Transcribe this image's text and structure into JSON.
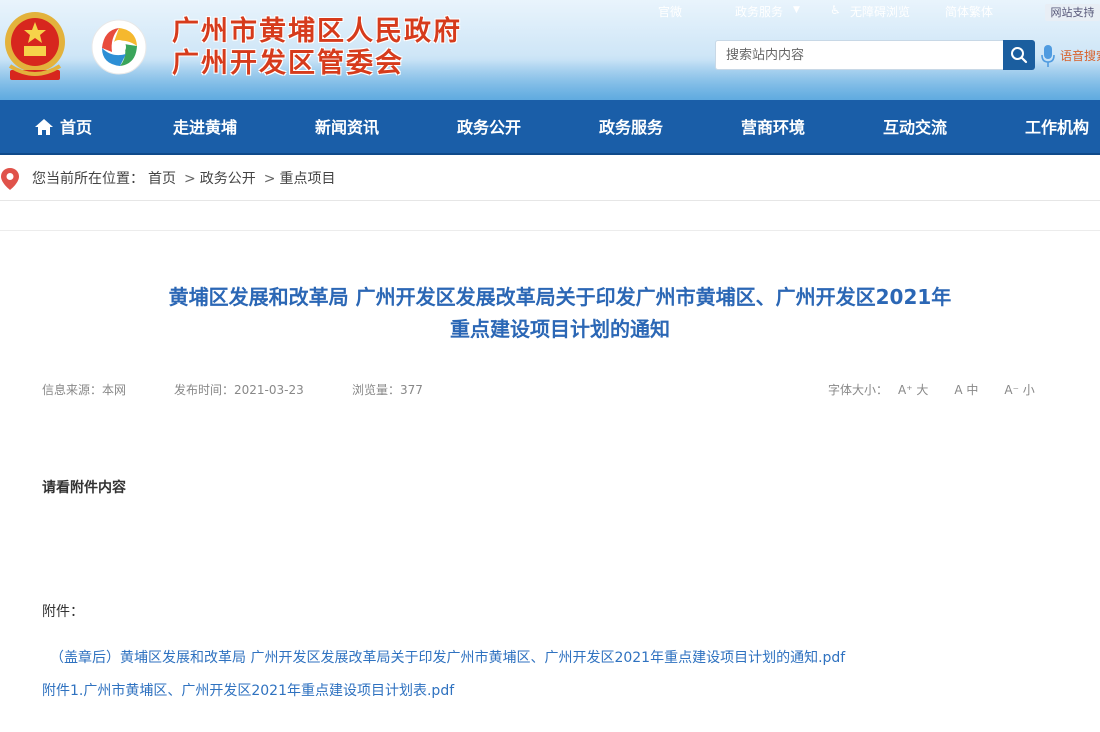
{
  "header": {
    "title_line1": "广州市黄埔区人民政府",
    "title_line2": "广州开发区管委会",
    "top_links": [
      "官微",
      "政务服务",
      "无障碍浏览",
      "简体繁体"
    ],
    "top_button": "网站支持",
    "search_placeholder": "搜索站内内容",
    "voice_label": "语音搜索"
  },
  "nav": {
    "items": [
      "首页",
      "走进黄埔",
      "新闻资讯",
      "政务公开",
      "政务服务",
      "营商环境",
      "互动交流",
      "工作机构"
    ]
  },
  "breadcrumb": {
    "prefix": "您当前所在位置：",
    "items": [
      "首页",
      "政务公开",
      "重点项目"
    ],
    "separator": ">"
  },
  "article": {
    "title_line1": "黄埔区发展和改革局 广州开发区发展改革局关于印发广州市黄埔区、广州开发区2021年",
    "title_line2": "重点建设项目计划的通知",
    "meta": {
      "source": "信息来源：本网",
      "date": "发布时间：2021-03-23",
      "views": "浏览量：377"
    },
    "font_size": {
      "label": "字体大小：",
      "options": [
        "A⁺ 大",
        "A 中",
        "A⁻ 小"
      ]
    },
    "body": "请看附件内容",
    "attachments_label": "附件：",
    "attachments": [
      "（盖章后）黄埔区发展和改革局 广州开发区发展改革局关于印发广州市黄埔区、广州开发区2021年重点建设项目计划的通知.pdf",
      "附件1.广州市黄埔区、广州开发区2021年重点建设项目计划表.pdf"
    ]
  },
  "colors": {
    "nav_bg": "#1a5ea8",
    "title_red": "#d63b1c",
    "article_title": "#2b67b5",
    "link": "#2f72c0"
  }
}
